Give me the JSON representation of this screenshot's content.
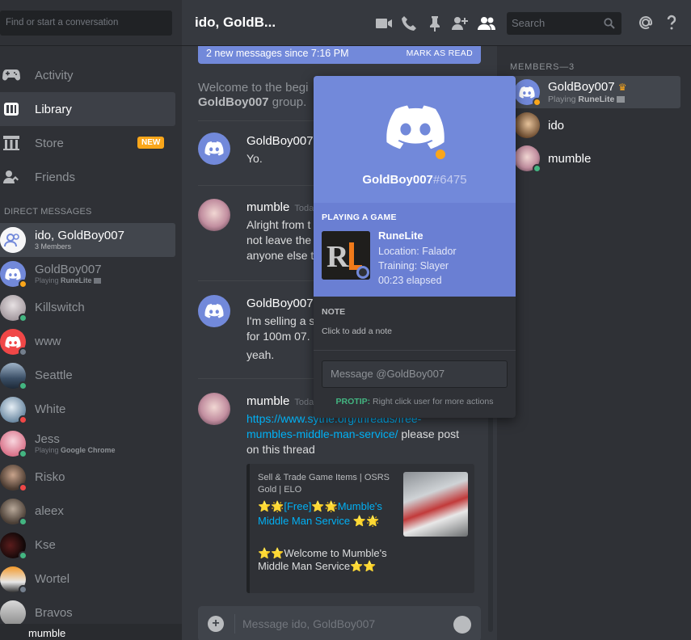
{
  "sidebar": {
    "search_placeholder": "Find or start a conversation",
    "nav": [
      {
        "label": "Activity",
        "icon": "gamepad-icon"
      },
      {
        "label": "Library",
        "icon": "library-icon"
      },
      {
        "label": "Store",
        "icon": "store-icon",
        "badge": "NEW"
      },
      {
        "label": "Friends",
        "icon": "friends-icon"
      }
    ],
    "dm_header": "DIRECT MESSAGES",
    "dms": [
      {
        "name": "ido, GoldBoy007",
        "sub": "3 Members"
      },
      {
        "name": "GoldBoy007",
        "sub_prefix": "Playing",
        "sub_game": "RuneLite"
      },
      {
        "name": "Killswitch"
      },
      {
        "name": "www"
      },
      {
        "name": "Seattle"
      },
      {
        "name": "White"
      },
      {
        "name": "Jess",
        "sub_prefix": "Playing",
        "sub_game": "Google Chrome"
      },
      {
        "name": "Risko"
      },
      {
        "name": "aleex"
      },
      {
        "name": "Kse"
      },
      {
        "name": "Wortel"
      },
      {
        "name": "Bravos"
      }
    ],
    "current_user": "mumble"
  },
  "topbar": {
    "channel_name": "ido, GoldB...",
    "search_placeholder": "Search"
  },
  "chat": {
    "new_messages": "2 new messages since 7:16 PM",
    "mark_as_read": "MARK AS READ",
    "welcome_line1": "Welcome to the begi",
    "welcome_bold": "GoldBoy007",
    "welcome_line2": " group.",
    "messages": [
      {
        "author": "GoldBoy007",
        "timestamp": "",
        "body": "Yo."
      },
      {
        "author": "mumble",
        "timestamp": "Toda",
        "body_lines": [
          "Alright from t",
          "not leave the",
          "anyone else t"
        ]
      },
      {
        "author": "GoldBoy007",
        "timestamp": "",
        "body_lines": [
          "I'm selling a s",
          "for 100m 07.",
          "yeah."
        ]
      },
      {
        "author": "mumble",
        "timestamp": "Toda",
        "link": "https://www.sythe.org/threads/free-mumbles-middle-man-service/",
        "link_line1": "https://www.sythe.org/threads/free-",
        "link_line2": "mumbles-middle-man-service/",
        "after_link": " please post",
        "body_end": "on this thread"
      }
    ],
    "embed": {
      "provider": "Sell & Trade Game Items | OSRS Gold | ELO",
      "title": "⭐🌟[Free]⭐🌟Mumble's Middle Man Service ⭐🌟",
      "description": "⭐⭐Welcome to Mumble's Middle Man Service⭐⭐"
    },
    "composer_placeholder": "Message ido, GoldBoy007"
  },
  "members": {
    "header": "MEMBERS—3",
    "list": [
      {
        "name": "GoldBoy007",
        "sub_prefix": "Playing",
        "sub_game": "RuneLite",
        "owner": true
      },
      {
        "name": "ido"
      },
      {
        "name": "mumble"
      }
    ]
  },
  "popout": {
    "username": "GoldBoy007",
    "discriminator": "#6475",
    "activity_header": "PLAYING A GAME",
    "game_name": "RuneLite",
    "game_line1": "Location: Falador",
    "game_line2": "Training: Slayer",
    "game_line3": "00:23 elapsed",
    "note_header": "NOTE",
    "note_placeholder": "Click to add a note",
    "message_placeholder": "Message @GoldBoy007",
    "protip_label": "PROTIP:",
    "protip_text": " Right click user for more actions"
  },
  "colors": {
    "blurple": "#7289da",
    "online": "#43b581",
    "idle": "#faa61a",
    "dnd": "#f04747",
    "link": "#00b0f4"
  }
}
